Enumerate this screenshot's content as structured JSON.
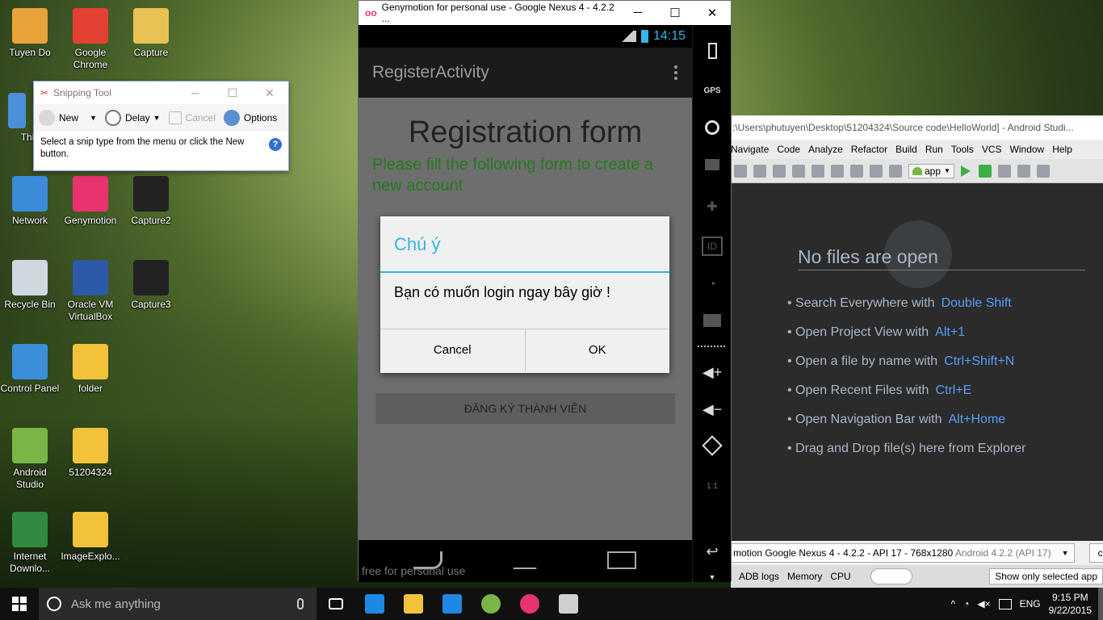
{
  "desktop": {
    "icons": [
      {
        "label": "Tuyen Do",
        "color": "#e8a33a"
      },
      {
        "label": "Google Chrome",
        "color": "#e34133"
      },
      {
        "label": "Capture",
        "color": "#e8c254"
      },
      {
        "label": "This",
        "color": "#4a90d9"
      },
      {
        "label": "Network",
        "color": "#3b8bd8"
      },
      {
        "label": "Genymotion",
        "color": "#e8336e"
      },
      {
        "label": "Capture2",
        "color": "#222222"
      },
      {
        "label": "Recycle Bin",
        "color": "#cfd8e0"
      },
      {
        "label": "Oracle VM VirtualBox",
        "color": "#2d5aa8"
      },
      {
        "label": "Capture3",
        "color": "#222222"
      },
      {
        "label": "Control Panel",
        "color": "#3a8fd8"
      },
      {
        "label": "folder",
        "color": "#f2c33a"
      },
      {
        "label": "Android Studio",
        "color": "#79b547"
      },
      {
        "label": "51204324",
        "color": "#f2c33a"
      },
      {
        "label": "Internet Downlo...",
        "color": "#2f8a3e"
      },
      {
        "label": "ImageExplo...",
        "color": "#f2c33a"
      }
    ]
  },
  "snipping_tool": {
    "title": "Snipping Tool",
    "new_label": "New",
    "delay_label": "Delay",
    "cancel_label": "Cancel",
    "options_label": "Options",
    "message": "Select a snip type from the menu or click the New button."
  },
  "genymotion": {
    "window_title": "Genymotion for personal use - Google Nexus 4 - 4.2.2 ...",
    "logo": "oo",
    "status_time": "14:15",
    "activity_title": "RegisterActivity",
    "form_title": "Registration form",
    "form_subtitle": "Please fill the following form to create a new account",
    "register_button": "ĐĂNG KÝ THÀNH VIÊN",
    "watermark": "free for personal use",
    "dialog": {
      "title": "Chú ý",
      "message": "Bạn có muốn login ngay bây giờ !",
      "cancel": "Cancel",
      "ok": "OK"
    },
    "side_panel": {
      "gps": "GPS",
      "id": "ID",
      "scale": "1:1"
    }
  },
  "android_studio": {
    "title": ":\\Users\\phutuyen\\Desktop\\51204324\\Source code\\HelloWorld] - Android Studi...",
    "menu": [
      "Navigate",
      "Code",
      "Analyze",
      "Refactor",
      "Build",
      "Run",
      "Tools",
      "VCS",
      "Window",
      "Help"
    ],
    "app_selector": "app",
    "no_files": "No files are open",
    "tips": [
      {
        "text": "• Search Everywhere with",
        "key": "Double Shift"
      },
      {
        "text": "• Open Project View with",
        "key": "Alt+1"
      },
      {
        "text": "• Open a file by name with",
        "key": "Ctrl+Shift+N"
      },
      {
        "text": "• Open Recent Files with",
        "key": "Ctrl+E"
      },
      {
        "text": "• Open Navigation Bar with",
        "key": "Alt+Home"
      },
      {
        "text": "• Drag and Drop file(s) here from Explorer",
        "key": ""
      }
    ],
    "device_selector": "motion Google Nexus 4 - 4.2.2 - API 17 - 768x1280",
    "device_detail": "Android 4.2.2 (API 17)",
    "com_selector": "com.",
    "log_tabs": [
      "ADB logs",
      "Memory",
      "CPU"
    ],
    "show_selected": "Show only selected app"
  },
  "taskbar": {
    "search_placeholder": "Ask me anything",
    "language": "ENG",
    "time": "9:15 PM",
    "date": "9/22/2015",
    "apps": [
      {
        "name": "task-view",
        "color": "#ffffff"
      },
      {
        "name": "edge",
        "color": "#1e88e5"
      },
      {
        "name": "file-explorer",
        "color": "#f2c33a"
      },
      {
        "name": "store",
        "color": "#1e88e5"
      },
      {
        "name": "android-studio",
        "color": "#79b547"
      },
      {
        "name": "genymotion",
        "color": "#e8336e"
      },
      {
        "name": "snipping-tool",
        "color": "#d0d0d0"
      }
    ]
  }
}
